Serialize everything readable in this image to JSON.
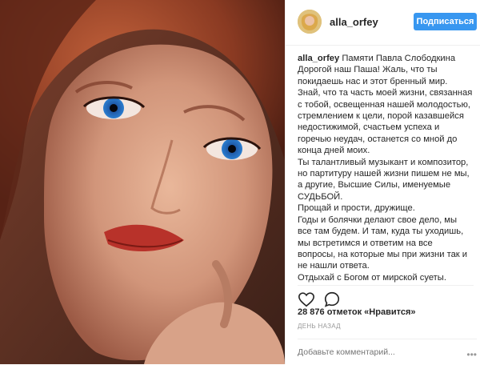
{
  "post": {
    "photo_description_icon": "portrait-photo",
    "header": {
      "username": "alla_orfey",
      "follow_label": "Подписаться"
    },
    "caption": {
      "username": "alla_orfey",
      "lines": [
        "Памяти Павла Слободкина",
        "Дорогой наш Паша! Жаль, что ты",
        "покидаешь нас и этот бренный мир.",
        "Знай, что та часть моей жизни, связанная",
        "с тобой, освещенная нашей молодостью,",
        "стремлением к цели, порой казавшейся",
        "недостижимой, счастьем успеха и",
        "горечью неудач, останется со мной до",
        "конца дней моих.",
        "Ты талантливый музыкант и композитор,",
        "но партитуру нашей жизни пишем не мы,",
        "а другие, Высшие Силы, именуемые",
        "СУДЬБОЙ.",
        "Прощай и прости, дружище.",
        "Годы и болячки делают свое дело, мы",
        "все там будем. И там, куда ты уходишь,",
        "мы встретимся и ответим на все",
        "вопросы, на которые мы при жизни так и",
        "не нашли ответа.",
        "Отдыхай с Богом от мирской суеты."
      ]
    },
    "likes_text": "28 876 отметок «Нравится»",
    "timestamp": "ДЕНЬ НАЗАД",
    "comment_placeholder": "Добавьте комментарий...",
    "colors": {
      "follow_button": "#3897f0",
      "text": "#262626",
      "muted": "#999999"
    }
  }
}
